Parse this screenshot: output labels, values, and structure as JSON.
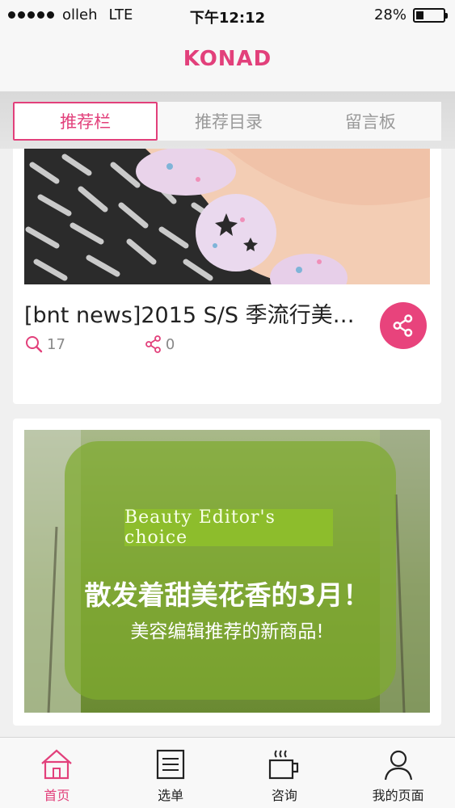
{
  "status_bar": {
    "carrier": "olleh",
    "network": "LTE",
    "time": "下午12:12",
    "battery_text": "28%",
    "battery_level": 0.28
  },
  "navbar": {
    "title": "KONAD"
  },
  "tabs": [
    {
      "label": "推荐栏",
      "active": true
    },
    {
      "label": "推荐目录",
      "active": false
    },
    {
      "label": "留言板",
      "active": false
    }
  ],
  "cards": [
    {
      "title": "[bnt news]2015 S/S 季流行美…",
      "views": "17",
      "shares": "0",
      "image_icon": "nail-art-photo"
    },
    {
      "image_icon": "beauty-editor-banner",
      "banner_tag": "Beauty Editor's choice",
      "banner_headline": "散发着甜美花香的3月！",
      "banner_subline": "美容编辑推荐的新商品!"
    }
  ],
  "tabbar": [
    {
      "label": "首页",
      "icon": "home-icon",
      "active": true
    },
    {
      "label": "选单",
      "icon": "menu-list-icon",
      "active": false
    },
    {
      "label": "咨询",
      "icon": "coffee-cup-icon",
      "active": false
    },
    {
      "label": "我的页面",
      "icon": "person-icon",
      "active": false
    }
  ],
  "colors": {
    "accent": "#e2407b",
    "share_button": "#e8437c"
  }
}
